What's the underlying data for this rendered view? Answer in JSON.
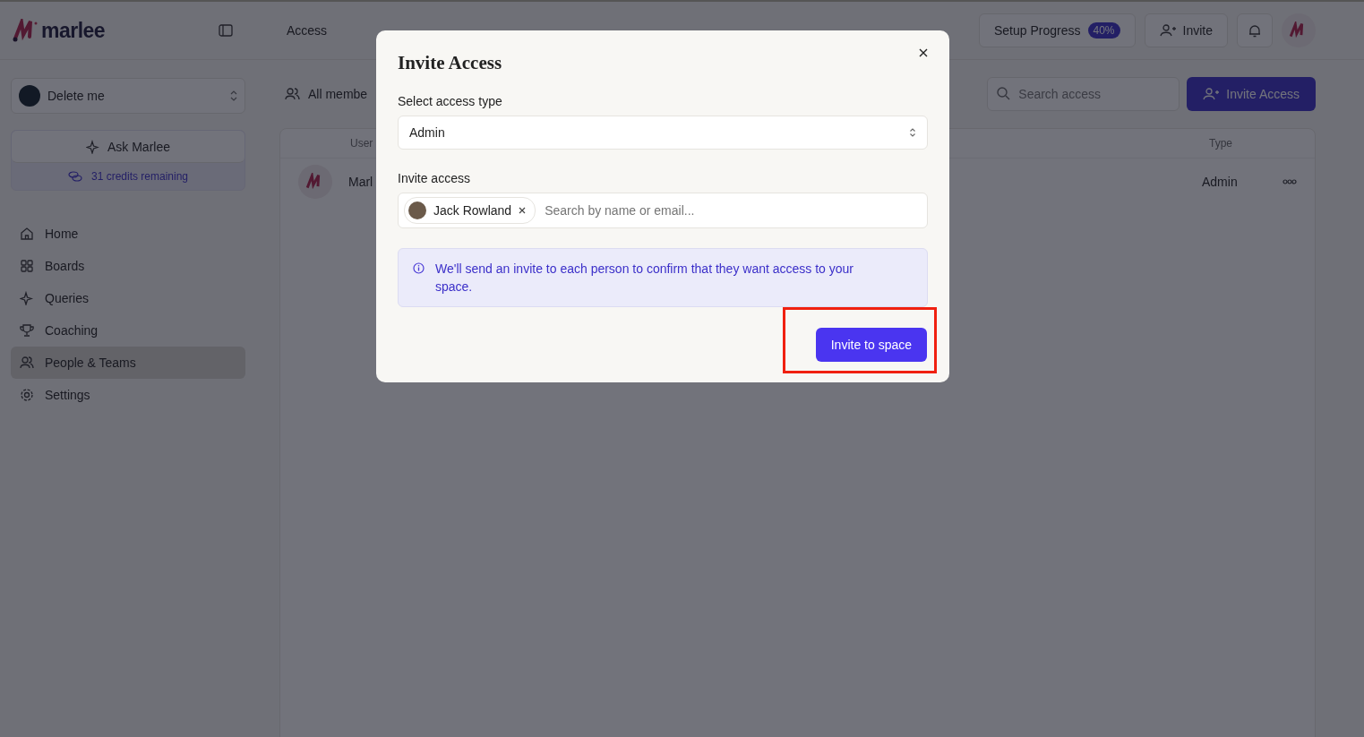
{
  "header": {
    "logo": "marlee",
    "breadcrumb": "Access",
    "setup_progress": {
      "label": "Setup Progress",
      "badge": "40%"
    },
    "invite_button": "Invite"
  },
  "sidebar": {
    "workspace": "Delete me",
    "ask_button": "Ask Marlee",
    "credits": "31 credits remaining",
    "items": [
      {
        "label": "Home",
        "selected": false
      },
      {
        "label": "Boards",
        "selected": false
      },
      {
        "label": "Queries",
        "selected": false
      },
      {
        "label": "Coaching",
        "selected": false
      },
      {
        "label": "People & Teams",
        "selected": true
      },
      {
        "label": "Settings",
        "selected": false
      }
    ]
  },
  "content": {
    "filter": "All membe",
    "search": {
      "placeholder": "Search access"
    },
    "invite_access_button": "Invite Access",
    "table": {
      "columns": [
        "User",
        "Type"
      ],
      "rows": [
        {
          "user": "Marl",
          "type": "Admin"
        }
      ]
    }
  },
  "dialog": {
    "title": "Invite Access",
    "access_type_label": "Select access type",
    "access_type": "Admin",
    "invite_label": "Invite access",
    "chips": [
      {
        "name": "Jack Rowland"
      }
    ],
    "invite_search": {
      "placeholder": "Search by name or email..."
    },
    "info": "We'll send an invite to each person to confirm that they want access to your space.",
    "submit": {
      "label": "Invite to space",
      "highlighted": true
    }
  }
}
